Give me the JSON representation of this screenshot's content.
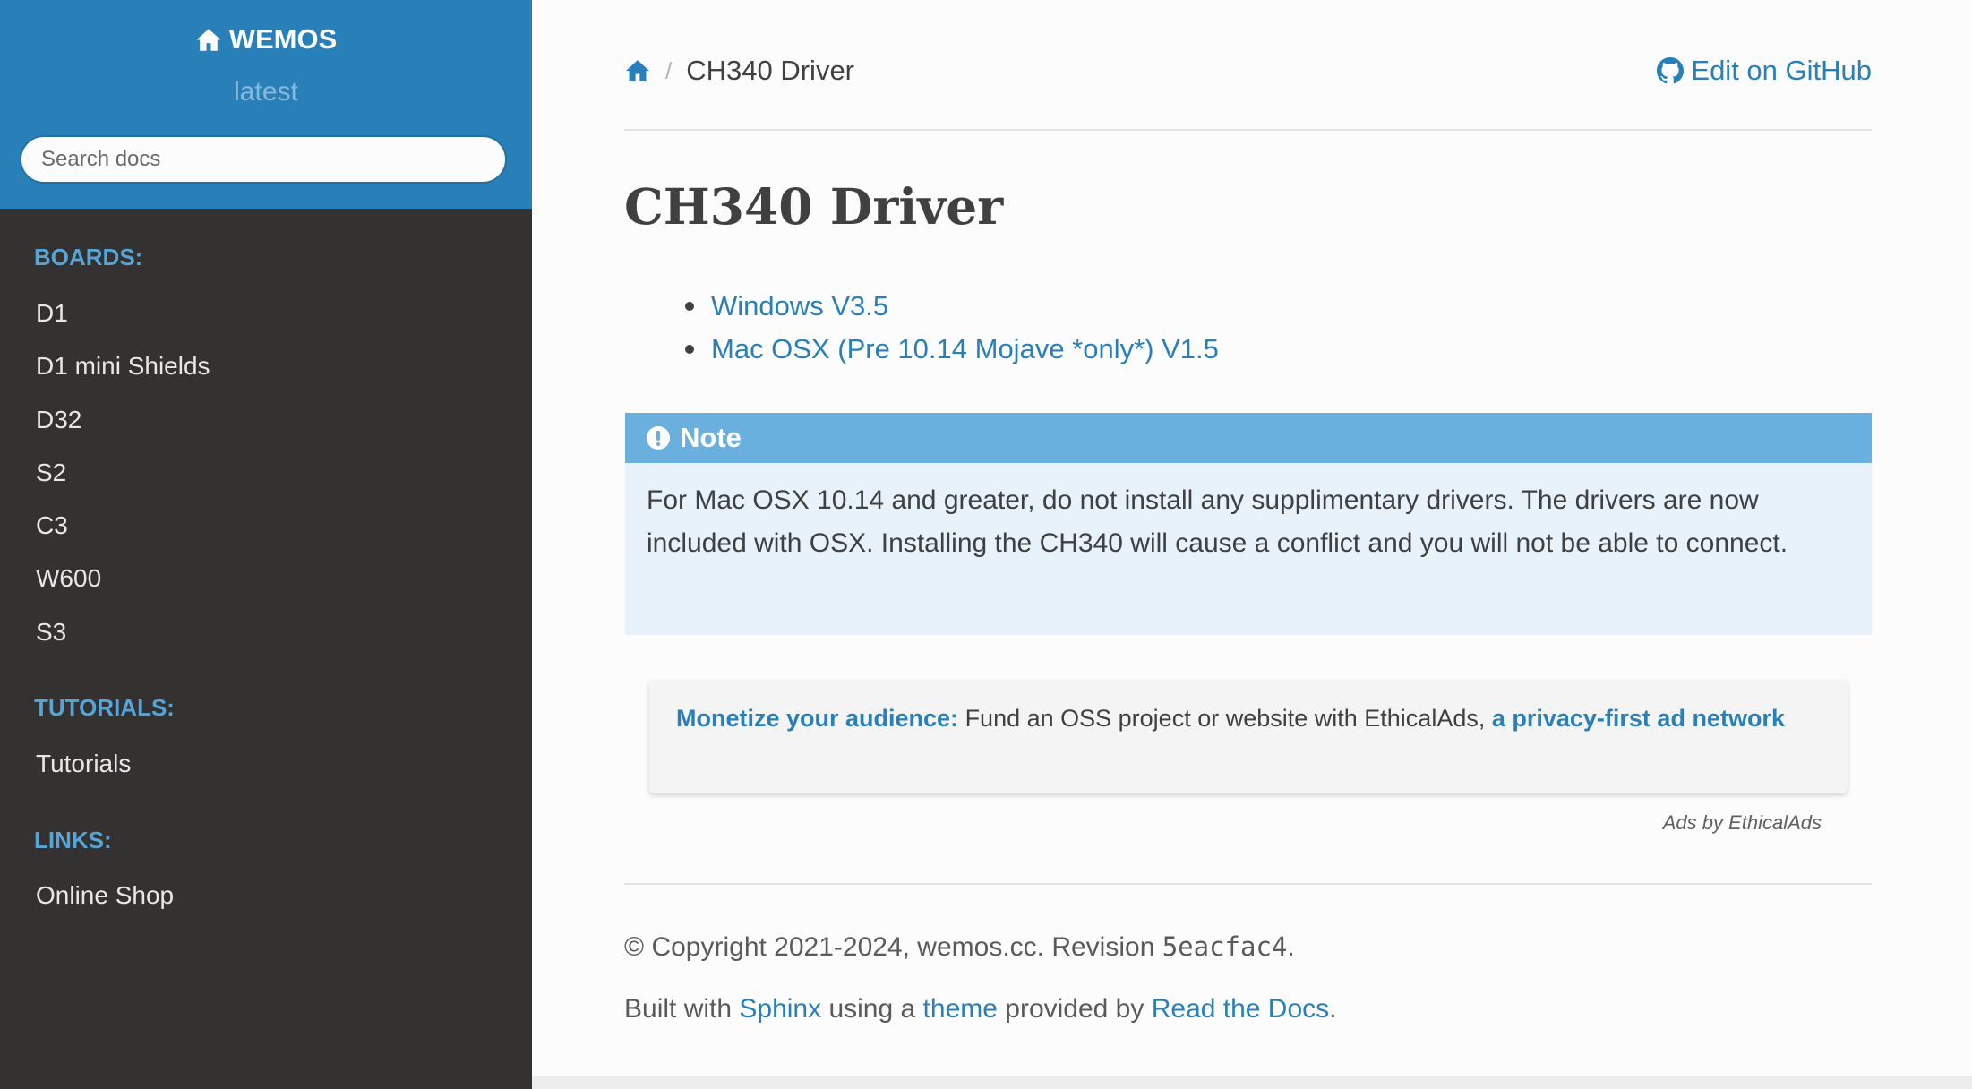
{
  "sidebar": {
    "project_name": "WEMOS",
    "version": "latest",
    "search_placeholder": "Search docs",
    "sections": [
      {
        "caption": "BOARDS:",
        "items": [
          "D1",
          "D1 mini Shields",
          "D32",
          "S2",
          "C3",
          "W600",
          "S3"
        ]
      },
      {
        "caption": "TUTORIALS:",
        "items": [
          "Tutorials"
        ]
      },
      {
        "caption": "LINKS:",
        "items": [
          "Online Shop"
        ]
      }
    ]
  },
  "breadcrumb": {
    "separator": "/",
    "current": "CH340 Driver"
  },
  "edit_link": "Edit on GitHub",
  "page": {
    "title": "CH340 Driver",
    "links": [
      "Windows V3.5",
      "Mac OSX (Pre 10.14 Mojave *only*) V1.5"
    ],
    "note": {
      "title": "Note",
      "body": "For Mac OSX 10.14 and greater, do not install any supplimentary drivers. The drivers are now included with OSX. Installing the CH340 will cause a conflict and you will not be able to connect."
    }
  },
  "ad": {
    "headline": "Monetize your audience:",
    "text": " Fund an OSS project or website with EthicalAds, ",
    "link": "a privacy-first ad network",
    "by": "Ads by EthicalAds"
  },
  "footer": {
    "copyright_prefix": "© Copyright 2021-2024, wemos.cc. Revision ",
    "revision": "5eacfac4",
    "copyright_suffix": ".",
    "built_prefix": "Built with ",
    "sphinx": "Sphinx",
    "using": " using a ",
    "theme": "theme",
    "provided": " provided by ",
    "rtd": "Read the Docs",
    "end": "."
  },
  "colors": {
    "sidebar_header": "#2980b9",
    "sidebar_body": "#343131",
    "link": "#2980b9",
    "caption": "#55a5d9",
    "note_header": "#6ab0de",
    "note_body": "#e7f2fa"
  }
}
